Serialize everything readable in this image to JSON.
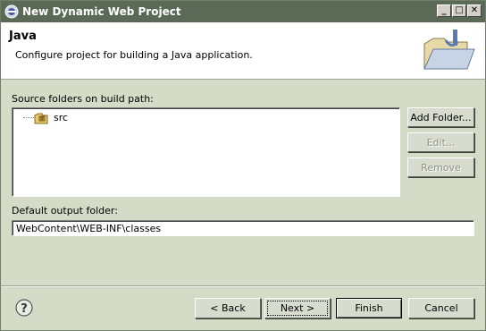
{
  "window": {
    "title": "New Dynamic Web Project",
    "controls": {
      "minimize": "_",
      "maximize": "□",
      "close": "✕"
    }
  },
  "header": {
    "title": "Java",
    "description": "Configure project for building a Java application.",
    "icon": "folder-with-java-icon"
  },
  "source_folders": {
    "label": "Source folders on build path:",
    "items": [
      {
        "label": "src",
        "icon": "package-folder-icon"
      }
    ]
  },
  "side_buttons": {
    "add_folder": "Add Folder...",
    "edit": "Edit...",
    "remove": "Remove"
  },
  "output": {
    "label": "Default output folder:",
    "value": "WebContent\\WEB-INF\\classes"
  },
  "footer": {
    "help_icon": "help-icon",
    "back": "< Back",
    "next": "Next >",
    "finish": "Finish",
    "cancel": "Cancel"
  },
  "colors": {
    "title_bar": "#5a6a57",
    "dialog_bg": "#d4dcc8",
    "header_bg": "#ffffff"
  }
}
